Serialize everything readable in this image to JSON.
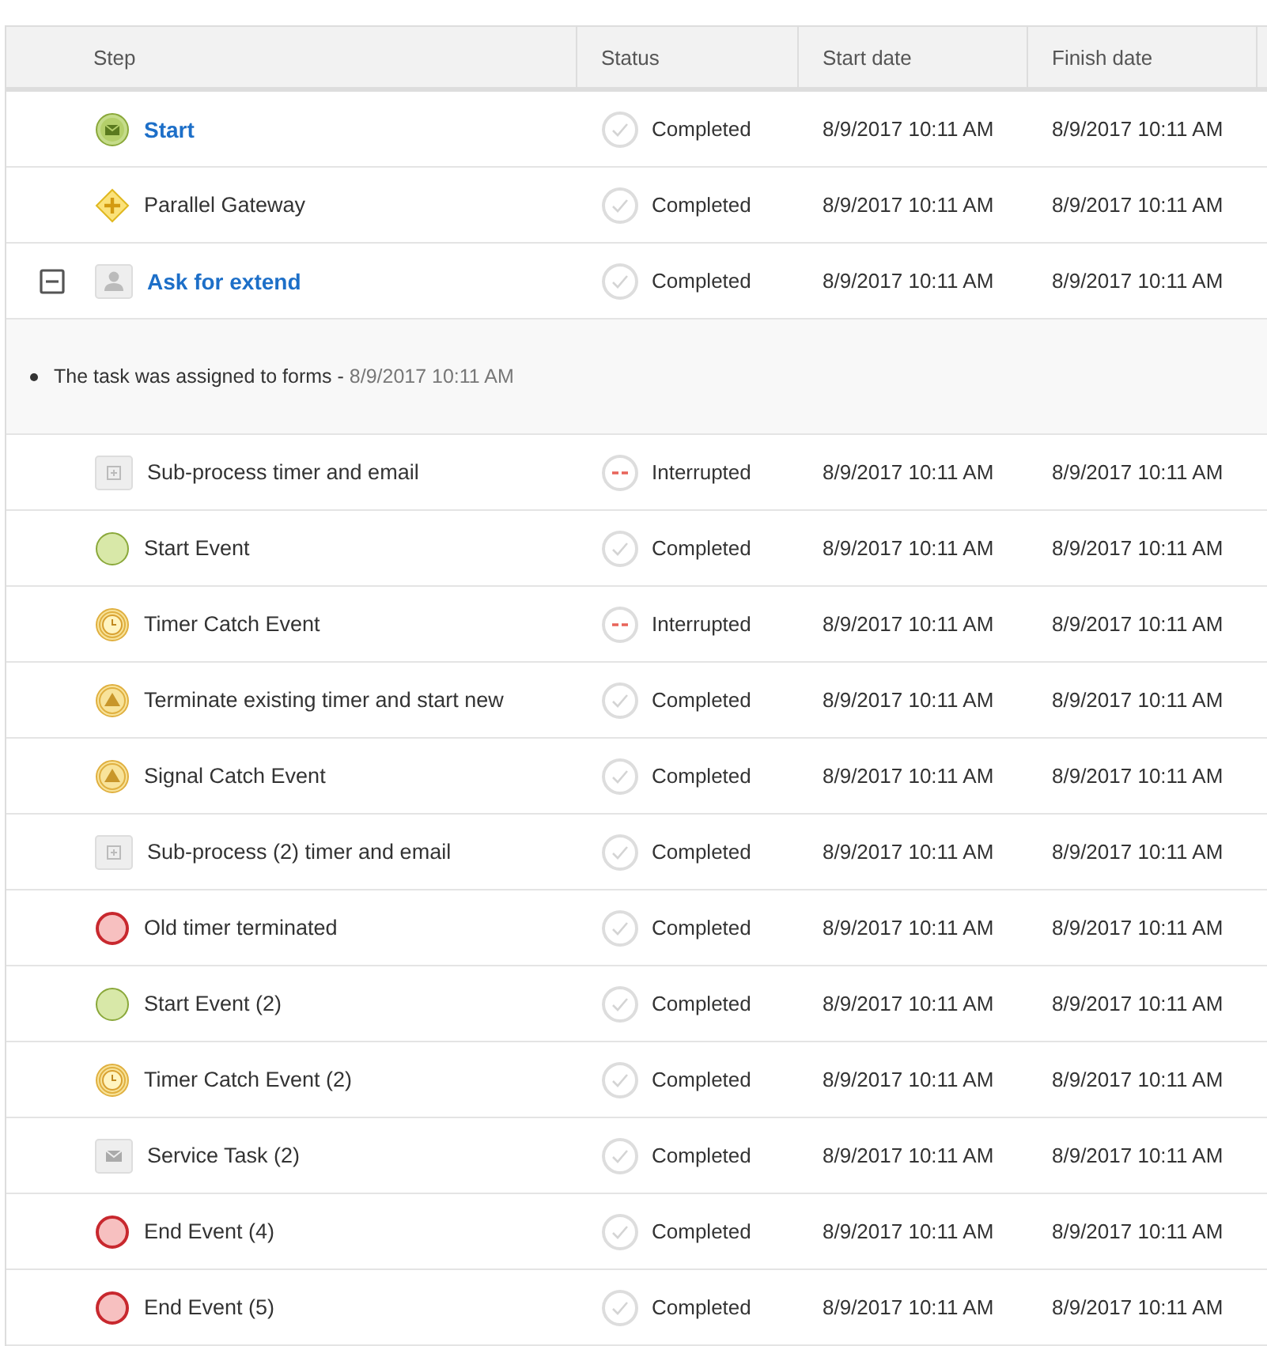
{
  "table": {
    "columns": [
      "Step",
      "Status",
      "Start date",
      "Finish date"
    ],
    "rows": [
      {
        "kind": "message-start",
        "step": "Start",
        "link": true,
        "status": "Completed",
        "interrupted": false,
        "start": "8/9/2017 10:11 AM",
        "finish": "8/9/2017 10:11 AM"
      },
      {
        "kind": "gateway",
        "step": "Parallel Gateway",
        "link": false,
        "status": "Completed",
        "interrupted": false,
        "start": "8/9/2017 10:11 AM",
        "finish": "8/9/2017 10:11 AM"
      },
      {
        "kind": "user-task",
        "step": "Ask for extend",
        "link": true,
        "expanded": true,
        "status": "Completed",
        "interrupted": false,
        "start": "8/9/2017 10:11 AM",
        "finish": "8/9/2017 10:11 AM",
        "details": [
          {
            "text": "The task was assigned to forms - ",
            "date": "8/9/2017 10:11 AM"
          }
        ]
      },
      {
        "kind": "subprocess",
        "step": "Sub-process timer and email",
        "link": false,
        "status": "Interrupted",
        "interrupted": true,
        "start": "8/9/2017 10:11 AM",
        "finish": "8/9/2017 10:11 AM"
      },
      {
        "kind": "start",
        "step": "Start Event",
        "link": false,
        "status": "Completed",
        "interrupted": false,
        "start": "8/9/2017 10:11 AM",
        "finish": "8/9/2017 10:11 AM"
      },
      {
        "kind": "timer",
        "step": "Timer Catch Event",
        "link": false,
        "status": "Interrupted",
        "interrupted": true,
        "start": "8/9/2017 10:11 AM",
        "finish": "8/9/2017 10:11 AM"
      },
      {
        "kind": "signal",
        "step": "Terminate existing timer and start new",
        "link": false,
        "status": "Completed",
        "interrupted": false,
        "start": "8/9/2017 10:11 AM",
        "finish": "8/9/2017 10:11 AM"
      },
      {
        "kind": "signal",
        "step": "Signal Catch Event",
        "link": false,
        "status": "Completed",
        "interrupted": false,
        "start": "8/9/2017 10:11 AM",
        "finish": "8/9/2017 10:11 AM"
      },
      {
        "kind": "subprocess",
        "step": "Sub-process (2) timer and email",
        "link": false,
        "status": "Completed",
        "interrupted": false,
        "start": "8/9/2017 10:11 AM",
        "finish": "8/9/2017 10:11 AM"
      },
      {
        "kind": "end",
        "step": "Old timer terminated",
        "link": false,
        "status": "Completed",
        "interrupted": false,
        "start": "8/9/2017 10:11 AM",
        "finish": "8/9/2017 10:11 AM"
      },
      {
        "kind": "start",
        "step": "Start Event (2)",
        "link": false,
        "status": "Completed",
        "interrupted": false,
        "start": "8/9/2017 10:11 AM",
        "finish": "8/9/2017 10:11 AM"
      },
      {
        "kind": "timer",
        "step": "Timer Catch Event (2)",
        "link": false,
        "status": "Completed",
        "interrupted": false,
        "start": "8/9/2017 10:11 AM",
        "finish": "8/9/2017 10:11 AM"
      },
      {
        "kind": "service-task",
        "step": "Service Task (2)",
        "link": false,
        "status": "Completed",
        "interrupted": false,
        "start": "8/9/2017 10:11 AM",
        "finish": "8/9/2017 10:11 AM"
      },
      {
        "kind": "end",
        "step": "End Event (4)",
        "link": false,
        "status": "Completed",
        "interrupted": false,
        "start": "8/9/2017 10:11 AM",
        "finish": "8/9/2017 10:11 AM"
      },
      {
        "kind": "end",
        "step": "End Event (5)",
        "link": false,
        "status": "Completed",
        "interrupted": false,
        "start": "8/9/2017 10:11 AM",
        "finish": "8/9/2017 10:11 AM"
      }
    ]
  }
}
